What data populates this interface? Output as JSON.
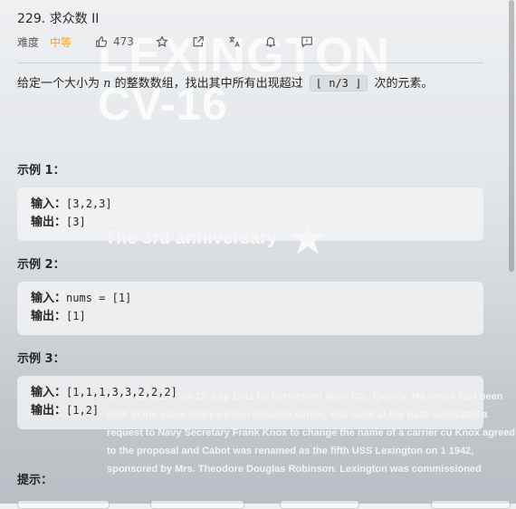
{
  "problem": {
    "title": "229. 求众数 II",
    "difficulty_label": "难度",
    "difficulty": "中等",
    "likes": "473",
    "description_pre": "给定一个大小为 ",
    "description_var": "n",
    "description_mid": " 的整数数组，找出其中所有出现超过 ",
    "description_code": "⌊ n/3 ⌋",
    "description_post": " 次的元素。"
  },
  "examples": [
    {
      "heading": "示例 1：",
      "input_label": "输入：",
      "input": "[3,2,3]",
      "output_label": "输出：",
      "output": "[3]"
    },
    {
      "heading": "示例 2：",
      "input_label": "输入：",
      "input": "nums = [1]",
      "output_label": "输出：",
      "output": "[1]"
    },
    {
      "heading": "示例 3：",
      "input_label": "输入：",
      "input": "[1,1,1,3,3,2,2,2]",
      "output_label": "输出：",
      "output": "[1,2]"
    }
  ],
  "hint_heading": "提示：",
  "toolbar_icons": [
    "thumbs-up-icon",
    "star-icon",
    "share-icon",
    "translate-icon",
    "bell-icon",
    "feedback-icon"
  ],
  "colors": {
    "accent": "#ffa116",
    "text": "#262626"
  }
}
